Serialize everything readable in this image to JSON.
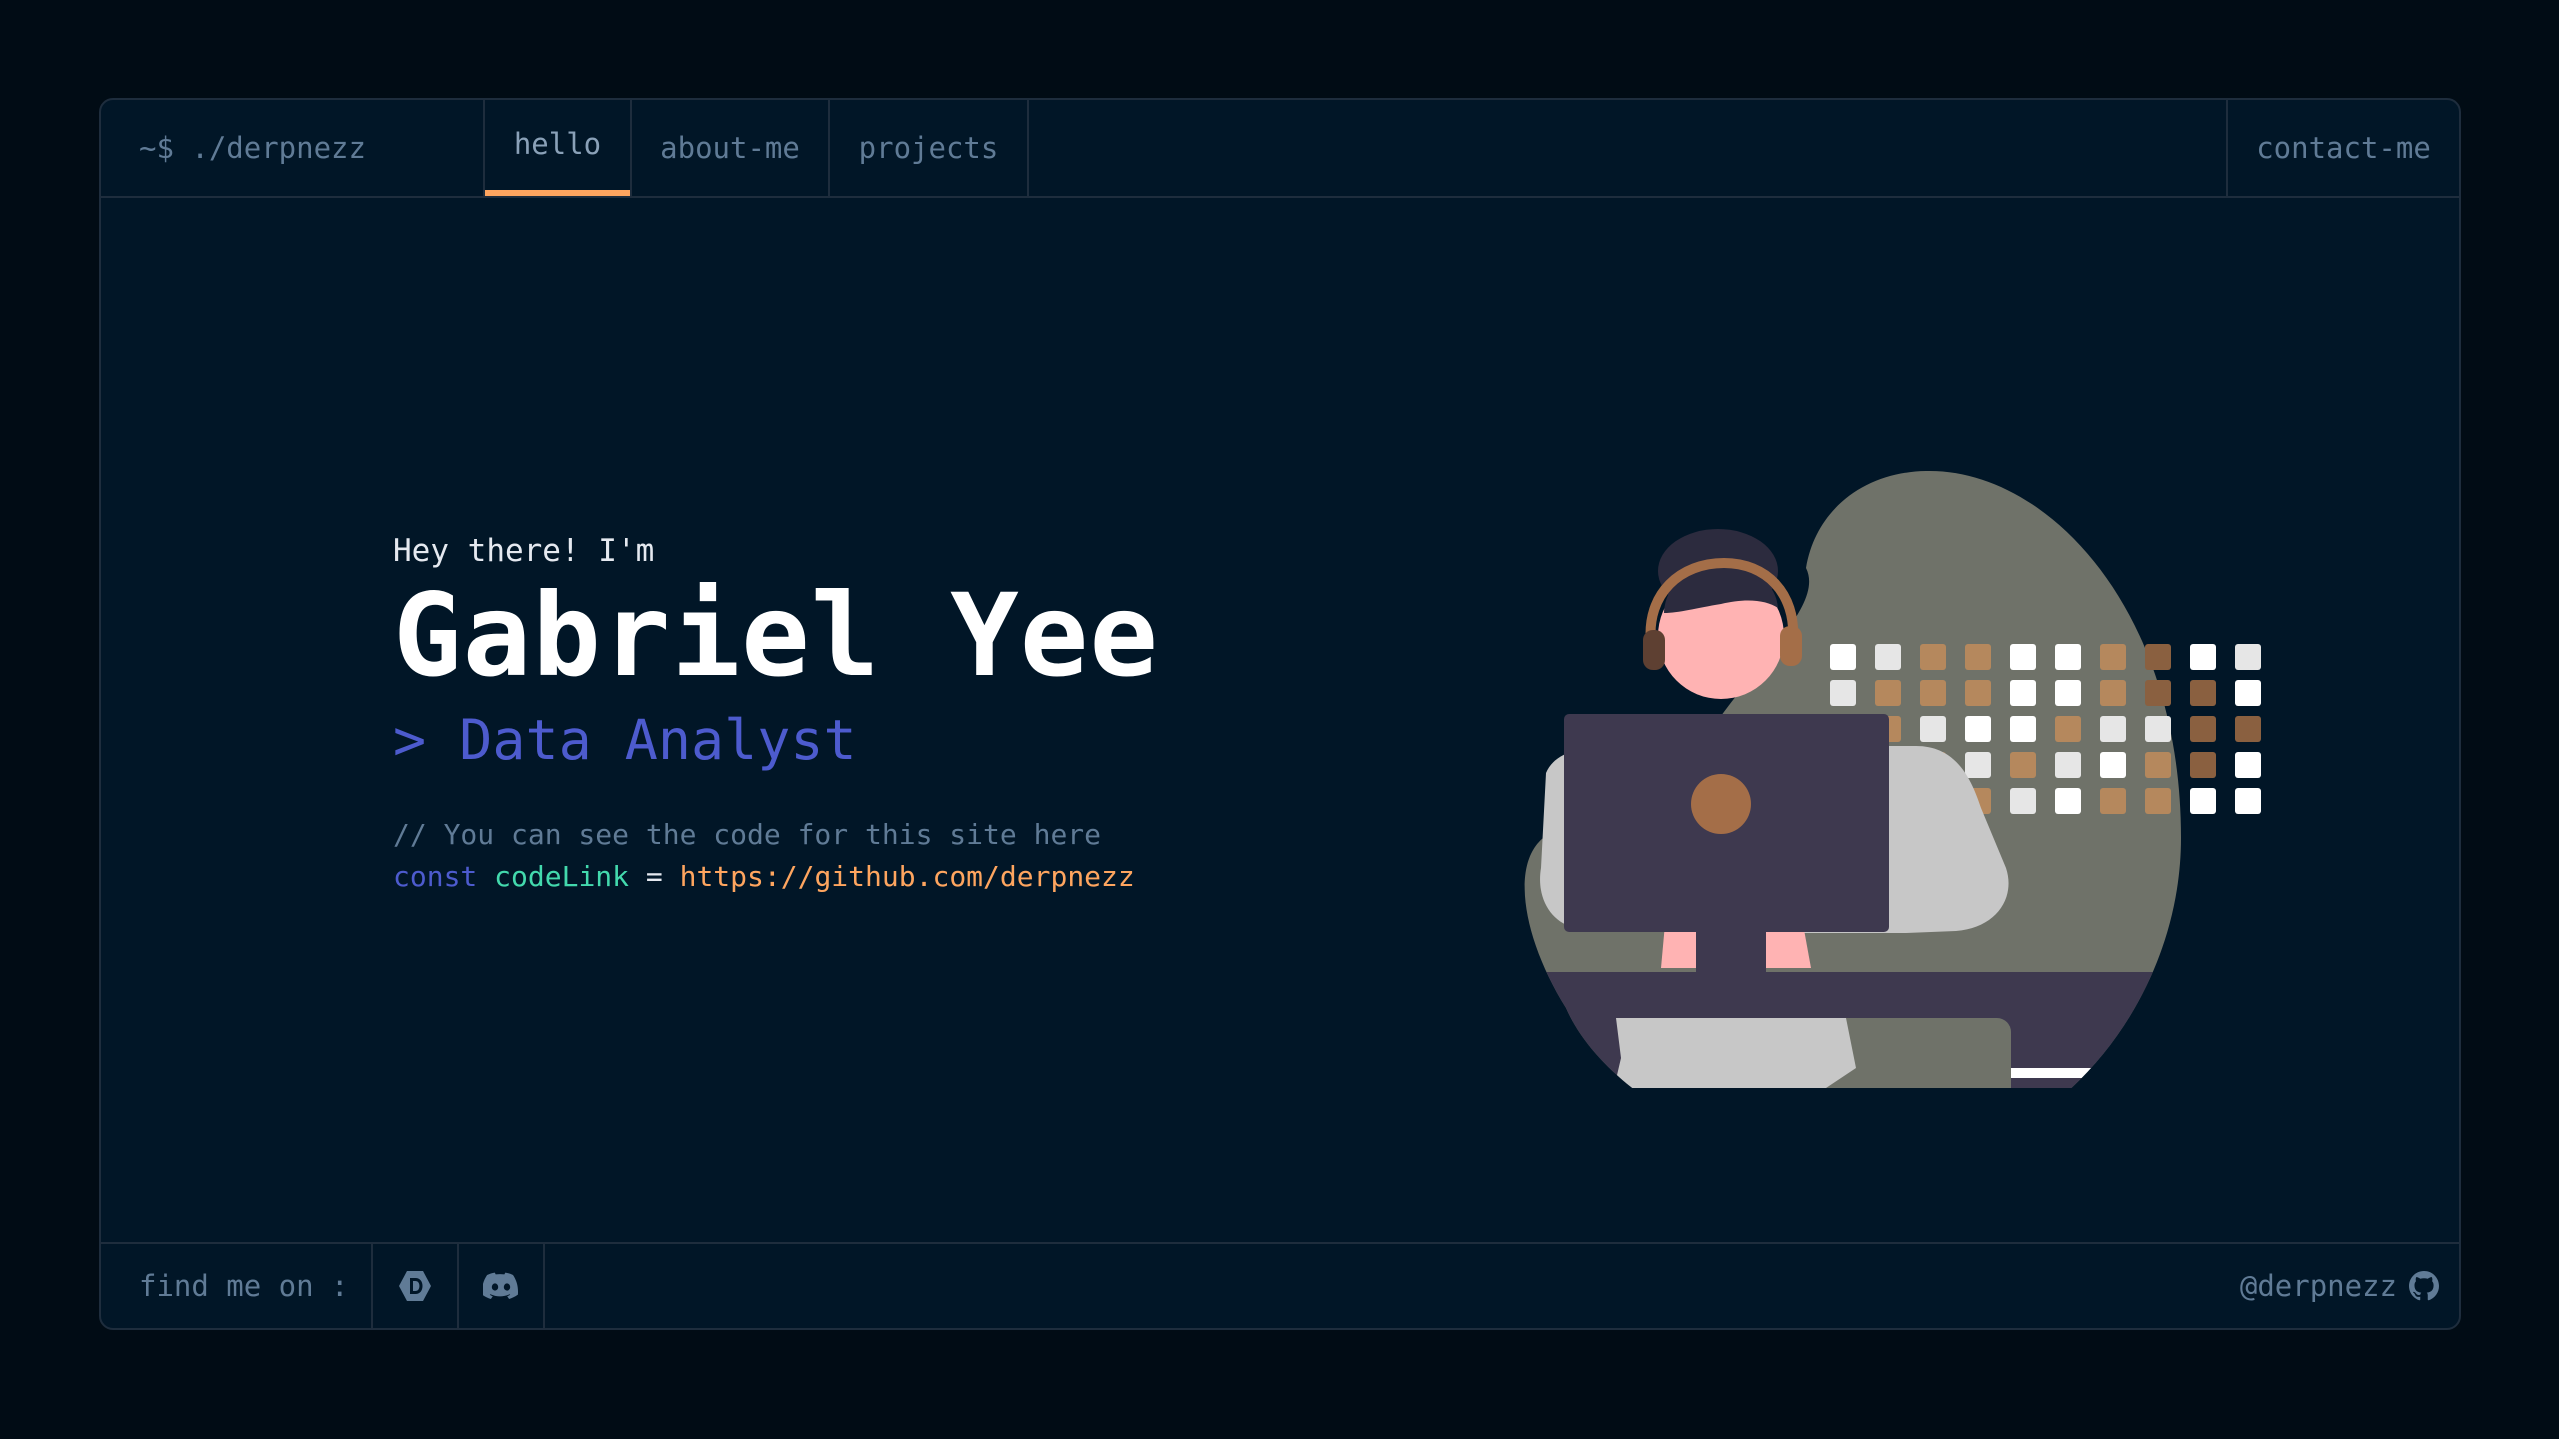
{
  "header": {
    "brand": "~$ ./derpnezz",
    "tabs": [
      {
        "label": "hello",
        "active": true
      },
      {
        "label": "about-me"
      },
      {
        "label": "projects"
      }
    ],
    "contact_label": "contact-me"
  },
  "hero": {
    "greeting": "Hey there! I'm",
    "name": "Gabriel Yee",
    "role": "> Data Analyst",
    "comment": "// You can see the code for this site here",
    "code": {
      "keyword": "const",
      "variable": "codeLink",
      "operator": "=",
      "value": "https://github.com/derpnezz"
    }
  },
  "footer": {
    "find_label": "find me on :",
    "socials": [
      {
        "icon": "devpost-icon"
      },
      {
        "icon": "discord-icon"
      }
    ],
    "handle": "@derpnezz",
    "handle_icon": "github-icon"
  },
  "colors": {
    "background": "#010c15",
    "panel": "#011627",
    "border": "#1e2d3d",
    "accent_orange": "#fea55f",
    "accent_blue": "#4d5bce",
    "accent_green": "#43d9ad",
    "muted": "#607b96"
  }
}
